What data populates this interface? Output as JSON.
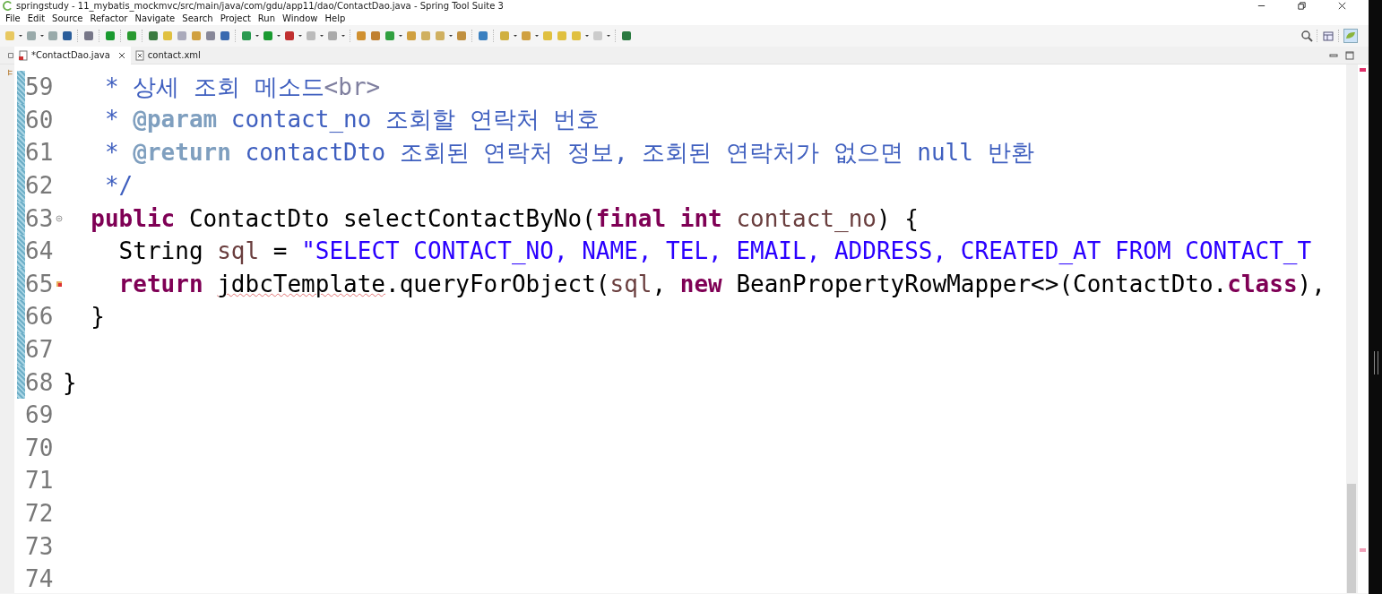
{
  "window": {
    "title": "springstudy - 11_mybatis_mockmvc/src/main/java/com/gdu/app11/dao/ContactDao.java - Spring Tool Suite 3"
  },
  "menu": [
    "File",
    "Edit",
    "Source",
    "Refactor",
    "Navigate",
    "Search",
    "Project",
    "Run",
    "Window",
    "Help"
  ],
  "tabs": [
    {
      "label": "*ContactDao.java",
      "kind": "java",
      "selected": true
    },
    {
      "label": "contact.xml",
      "kind": "xml",
      "selected": false
    }
  ],
  "editor": {
    "lines": [
      {
        "number": "59",
        "in_range": true,
        "fold_control": false,
        "error": false,
        "tokens": [
          {
            "kind": "comment",
            "text": "   * 상세 조회 메소드"
          },
          {
            "kind": "doc_html",
            "text": "<br>"
          }
        ]
      },
      {
        "number": "60",
        "in_range": true,
        "fold_control": false,
        "error": false,
        "tokens": [
          {
            "kind": "comment",
            "text": "   * "
          },
          {
            "kind": "doc_tag",
            "text": "@param"
          },
          {
            "kind": "comment",
            "text": " contact_no 조회할 연락처 번호"
          }
        ]
      },
      {
        "number": "61",
        "in_range": true,
        "fold_control": false,
        "error": false,
        "tokens": [
          {
            "kind": "comment",
            "text": "   * "
          },
          {
            "kind": "doc_tag",
            "text": "@return"
          },
          {
            "kind": "comment",
            "text": " contactDto 조회된 연락처 정보, 조회된 연락처가 없으면 null 반환"
          }
        ]
      },
      {
        "number": "62",
        "in_range": true,
        "fold_control": false,
        "error": false,
        "tokens": [
          {
            "kind": "comment",
            "text": "   */"
          }
        ]
      },
      {
        "number": "63",
        "in_range": true,
        "fold_control": true,
        "error": false,
        "tokens": [
          {
            "kind": "keyword",
            "text": "  public"
          },
          {
            "kind": "plain",
            "text": " ContactDto selectContactByNo("
          },
          {
            "kind": "keyword",
            "text": "final"
          },
          {
            "kind": "keyword",
            "text": " int "
          },
          {
            "kind": "variable",
            "text": "contact_no"
          },
          {
            "kind": "plain",
            "text": ") {"
          }
        ]
      },
      {
        "number": "64",
        "in_range": true,
        "fold_control": false,
        "error": false,
        "tokens": [
          {
            "kind": "plain",
            "text": "    String "
          },
          {
            "kind": "variable",
            "text": "sql"
          },
          {
            "kind": "plain",
            "text": " = "
          },
          {
            "kind": "string",
            "text": "\"SELECT CONTACT_NO, NAME, TEL, EMAIL, ADDRESS, CREATED_AT FROM CONTACT_T"
          }
        ]
      },
      {
        "number": "65",
        "in_range": true,
        "fold_control": false,
        "error": true,
        "tokens": [
          {
            "kind": "keyword",
            "text": "    return "
          },
          {
            "kind": "squiggle",
            "text": "jdbcTemplate"
          },
          {
            "kind": "plain",
            "text": ".queryForObject("
          },
          {
            "kind": "variable",
            "text": "sql"
          },
          {
            "kind": "plain",
            "text": ", "
          },
          {
            "kind": "keyword",
            "text": "new"
          },
          {
            "kind": "plain",
            "text": " BeanPropertyRowMapper<>(ContactDto."
          },
          {
            "kind": "keyword",
            "text": "class"
          },
          {
            "kind": "plain",
            "text": "),"
          }
        ]
      },
      {
        "number": "66",
        "in_range": true,
        "fold_control": false,
        "error": false,
        "tokens": [
          {
            "kind": "plain",
            "text": "  }"
          }
        ]
      },
      {
        "number": "67",
        "in_range": true,
        "fold_control": false,
        "error": false
      },
      {
        "number": "68",
        "in_range": true,
        "fold_control": false,
        "error": false,
        "tokens": [
          {
            "kind": "plain",
            "text": "}"
          }
        ]
      },
      {
        "number": "69",
        "in_range": false,
        "fold_control": false,
        "error": false
      },
      {
        "number": "70",
        "in_range": false,
        "fold_control": false,
        "error": false
      },
      {
        "number": "71",
        "in_range": false,
        "fold_control": false,
        "error": false
      },
      {
        "number": "72",
        "in_range": false,
        "fold_control": false,
        "error": false
      },
      {
        "number": "73",
        "in_range": false,
        "fold_control": false,
        "error": false
      },
      {
        "number": "74",
        "in_range": false,
        "fold_control": false,
        "error": false
      }
    ]
  }
}
